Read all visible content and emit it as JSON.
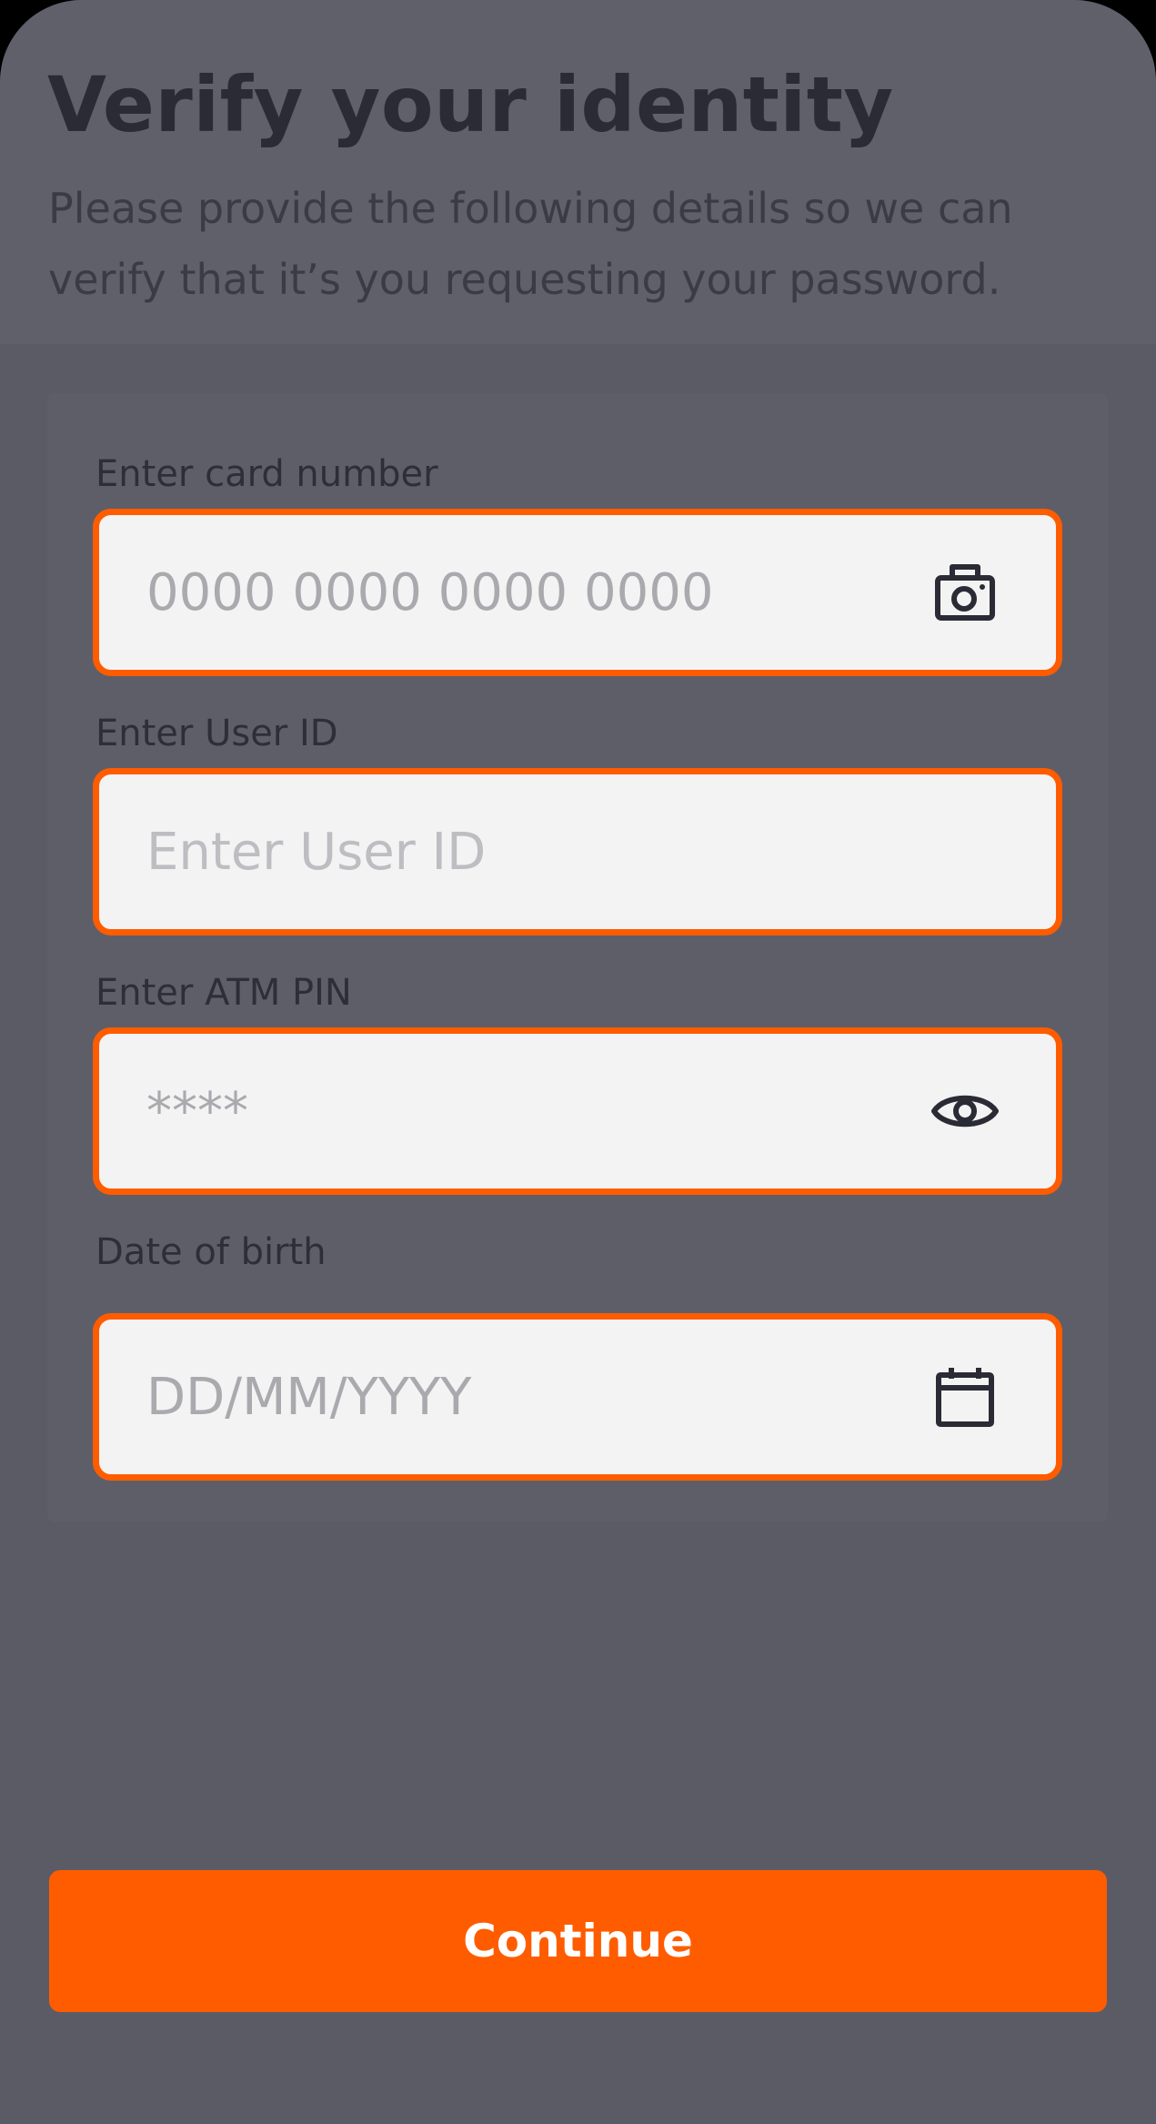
{
  "header": {
    "title": "Verify your identity",
    "subtitle": "Please provide the following details so we can verify that it’s you requesting your password."
  },
  "form": {
    "card_number": {
      "label": "Enter card number",
      "placeholder": "0000 0000 0000 0000",
      "icon": "camera-icon"
    },
    "user_id": {
      "label": "Enter User ID",
      "placeholder": "Enter User ID"
    },
    "atm_pin": {
      "label": "Enter ATM PIN",
      "placeholder": "****",
      "icon": "eye-icon"
    },
    "dob": {
      "label": "Date of birth",
      "placeholder": "DD/MM/YYYY",
      "icon": "calendar-icon"
    }
  },
  "actions": {
    "continue_label": "Continue"
  },
  "colors": {
    "accent": "#ff5c00",
    "overlay": "#5b5b65",
    "field_bg": "#f3f3f3",
    "icon": "#2b2b36"
  }
}
